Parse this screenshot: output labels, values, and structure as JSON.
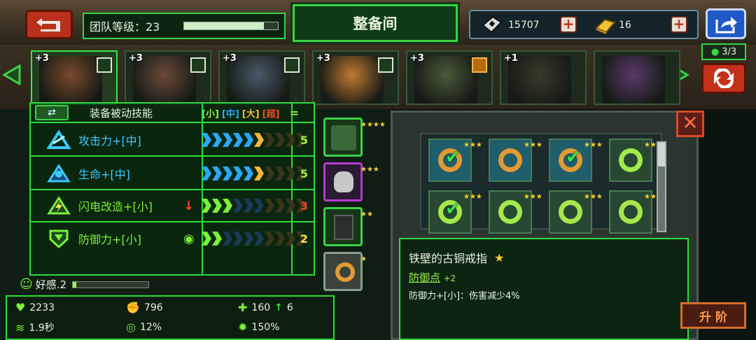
{
  "header": {
    "team_level_label": "团队等级：23",
    "team_level_progress": 0.85,
    "title": "整备间",
    "currency_1_value": "15707",
    "currency_2_value": "16"
  },
  "heroes": [
    {
      "level": "+3",
      "selected": true
    },
    {
      "level": "+3",
      "selected": false
    },
    {
      "level": "+3",
      "selected": false
    },
    {
      "level": "+3",
      "selected": false
    },
    {
      "level": "+3",
      "selected": false
    },
    {
      "level": "+1",
      "selected": false
    },
    {
      "level": "",
      "selected": false
    }
  ],
  "team_count": "3/3",
  "passive_panel": {
    "title": "装备被动技能",
    "size_labels": [
      "[小]",
      "[中]",
      "[大]",
      "[超]"
    ],
    "equals": "=",
    "skills": [
      {
        "name": "攻击力+[中]",
        "value": "5",
        "value_color": "#9af24a",
        "filled_blue": 5,
        "filled_gold": 1,
        "total": 10
      },
      {
        "name": "生命+[中]",
        "value": "5",
        "value_color": "#9af24a",
        "filled_blue": 5,
        "filled_gold": 1,
        "total": 10
      },
      {
        "name": "闪电改造+[小]",
        "value": "3",
        "value_color": "#f04a2a",
        "filled_green": 3,
        "total": 10
      },
      {
        "name": "防御力+[小]",
        "value": "2",
        "value_color": "#f2e24a",
        "filled_green": 2,
        "total": 10
      }
    ]
  },
  "stats": {
    "affinity": "好感.2",
    "hp": "2233",
    "attack": "796",
    "speed_time": "1.9秒",
    "crit": "12%",
    "armor": "160",
    "armor_bonus": "6",
    "dmg_mult": "150%"
  },
  "detail": {
    "item_name": "铁壁的古铜戒指",
    "link_label": "防御点",
    "link_bonus": "+2",
    "effect": "防御力+[小]：伤害减少4%"
  },
  "upgrade_label": "升 阶",
  "colors": {
    "accent_green": "#2fdc3c",
    "chevron_blue": "#2aa8ff",
    "chevron_gold": "#f5b83a",
    "chevron_green": "#7cf03a"
  }
}
